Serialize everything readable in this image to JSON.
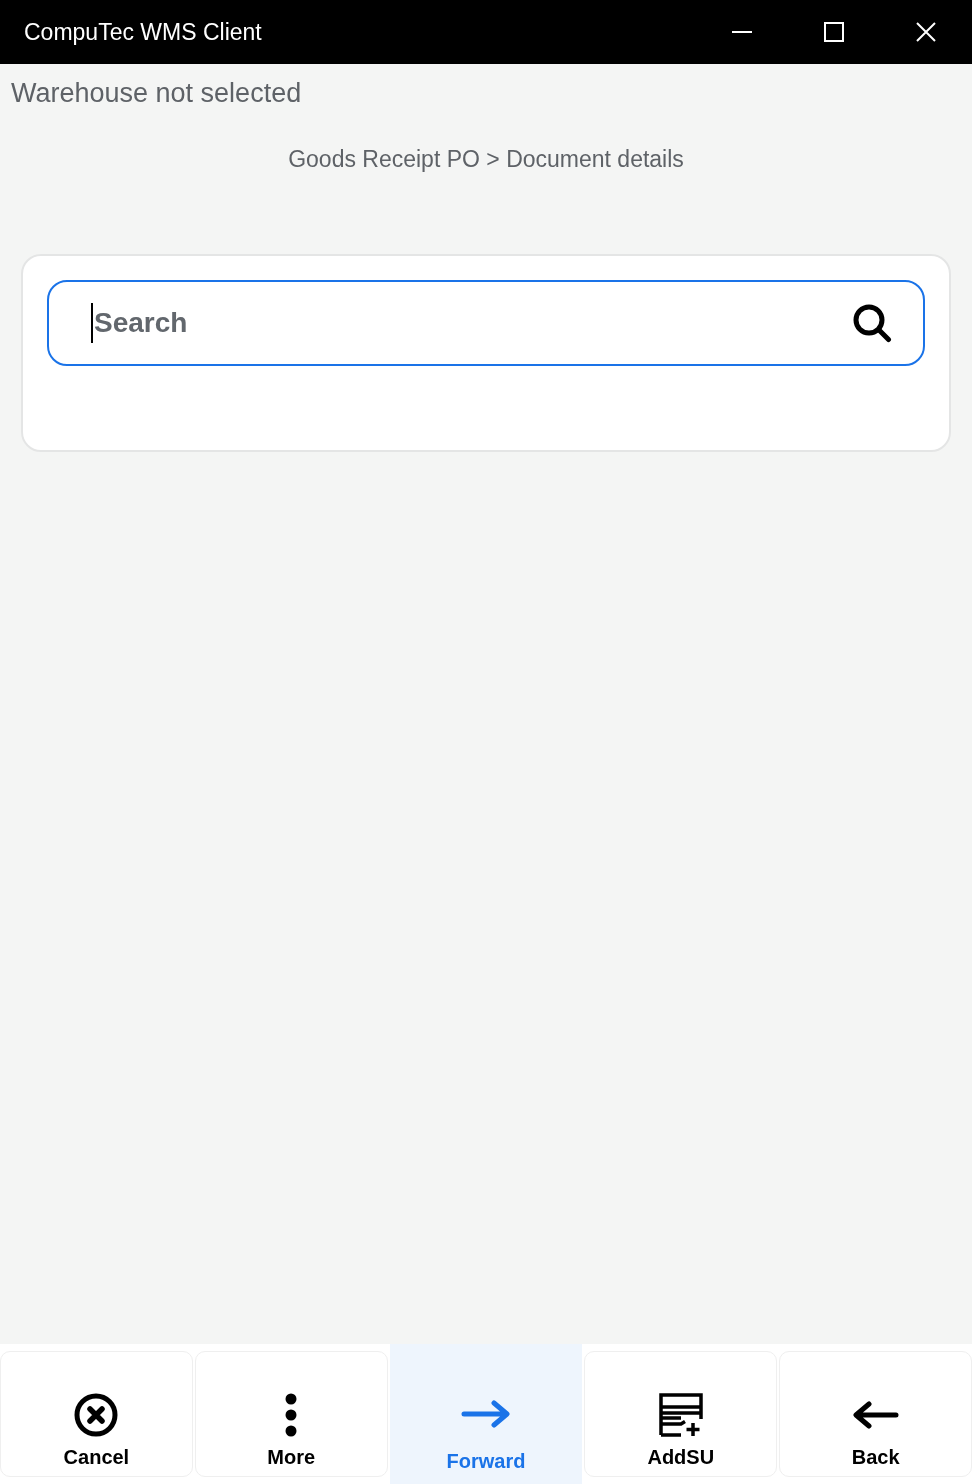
{
  "window": {
    "title": "CompuTec WMS Client"
  },
  "warehouse_status": "Warehouse not selected",
  "breadcrumb": "Goods Receipt PO > Document details",
  "search": {
    "placeholder": "Search",
    "focused": true
  },
  "toolbar": [
    {
      "label": "Cancel",
      "kind": "cancel",
      "selected": false
    },
    {
      "label": "More",
      "kind": "more",
      "selected": false
    },
    {
      "label": "Forward",
      "kind": "forward",
      "selected": true
    },
    {
      "label": "AddSU",
      "kind": "addsu",
      "selected": false
    },
    {
      "label": "Back",
      "kind": "back",
      "selected": false
    }
  ]
}
